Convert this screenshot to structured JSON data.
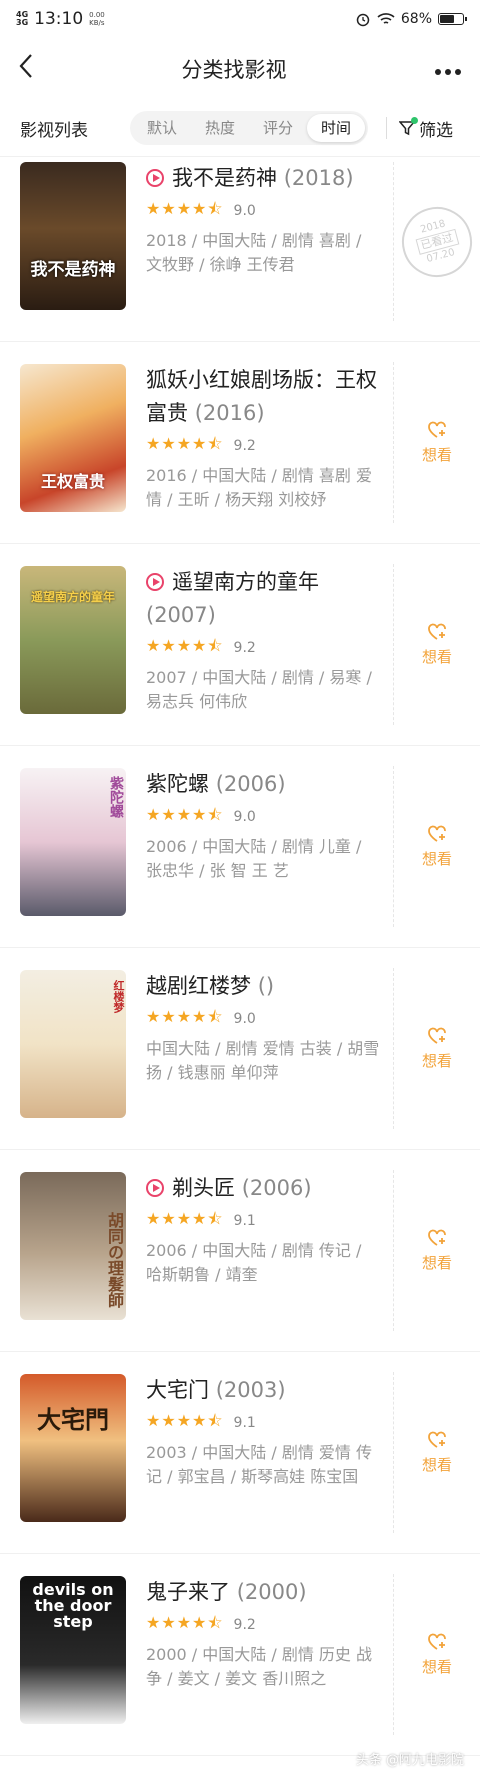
{
  "status": {
    "net1": "4G",
    "net2": "3G",
    "time": "13:10",
    "speed": "0.00",
    "speed_unit": "KB/s",
    "battery": "68%"
  },
  "nav": {
    "title": "分类找影视"
  },
  "filter": {
    "label": "影视列表",
    "tabs": [
      "默认",
      "热度",
      "评分",
      "时间"
    ],
    "active_index": 3,
    "filter_label": "筛选"
  },
  "colors": {
    "accent": "#f2a33a",
    "play": "#e9436a",
    "dot": "#2ec46b"
  },
  "movies": [
    {
      "title": "我不是药神",
      "year": "(2018)",
      "playable": true,
      "stars": 4.5,
      "score": "9.0",
      "meta": "2018 / 中国大陆 / 剧情 喜剧 / 文牧野 / 徐峥 王传君",
      "status": "watched",
      "stamp_year": "2018",
      "stamp_text": "已看过",
      "stamp_date": "07.20",
      "poster_text": "我不是药神"
    },
    {
      "title": "狐妖小红娘剧场版：王权富贵",
      "year": "(2016)",
      "playable": false,
      "stars": 4.5,
      "score": "9.2",
      "meta": "2016 / 中国大陆 / 剧情 喜剧 爱情 / 王昕 / 杨天翔 刘校妤",
      "status": "want",
      "want_label": "想看",
      "poster_text": "王权富贵"
    },
    {
      "title": "遥望南方的童年",
      "year": "(2007)",
      "playable": true,
      "stars": 4.5,
      "score": "9.2",
      "meta": "2007 / 中国大陆 / 剧情 / 易寒 / 易志兵 何伟欣",
      "status": "want",
      "want_label": "想看",
      "poster_text": "遥望南方的童年"
    },
    {
      "title": "紫陀螺",
      "year": "(2006)",
      "playable": false,
      "stars": 4.5,
      "score": "9.0",
      "meta": "2006 / 中国大陆 / 剧情 儿童 / 张忠华 / 张 智 王 艺",
      "status": "want",
      "want_label": "想看",
      "poster_text": "紫陀螺"
    },
    {
      "title": "越剧红楼梦",
      "year": "()",
      "playable": false,
      "stars": 4.5,
      "score": "9.0",
      "meta": "中国大陆 / 剧情 爱情 古装 / 胡雪扬 / 钱惠丽 单仰萍",
      "status": "want",
      "want_label": "想看",
      "poster_text": "红楼梦"
    },
    {
      "title": "剃头匠",
      "year": "(2006)",
      "playable": true,
      "stars": 4.5,
      "score": "9.1",
      "meta": "2006 / 中国大陆 / 剧情 传记 / 哈斯朝鲁 / 靖奎",
      "status": "want",
      "want_label": "想看",
      "poster_text": "胡同の理髮師"
    },
    {
      "title": "大宅门",
      "year": "(2003)",
      "playable": false,
      "stars": 4.5,
      "score": "9.1",
      "meta": "2003 / 中国大陆 / 剧情 爱情 传记 / 郭宝昌 / 斯琴高娃 陈宝国",
      "status": "want",
      "want_label": "想看",
      "poster_text": "大宅門"
    },
    {
      "title": "鬼子来了",
      "year": "(2000)",
      "playable": false,
      "stars": 4.5,
      "score": "9.2",
      "meta": "2000 / 中国大陆 / 剧情 历史 战争 / 姜文 / 姜文 香川照之",
      "status": "want",
      "want_label": "想看",
      "poster_text": "devils on the door step"
    }
  ],
  "watermark": "头条 @阿九电影院"
}
